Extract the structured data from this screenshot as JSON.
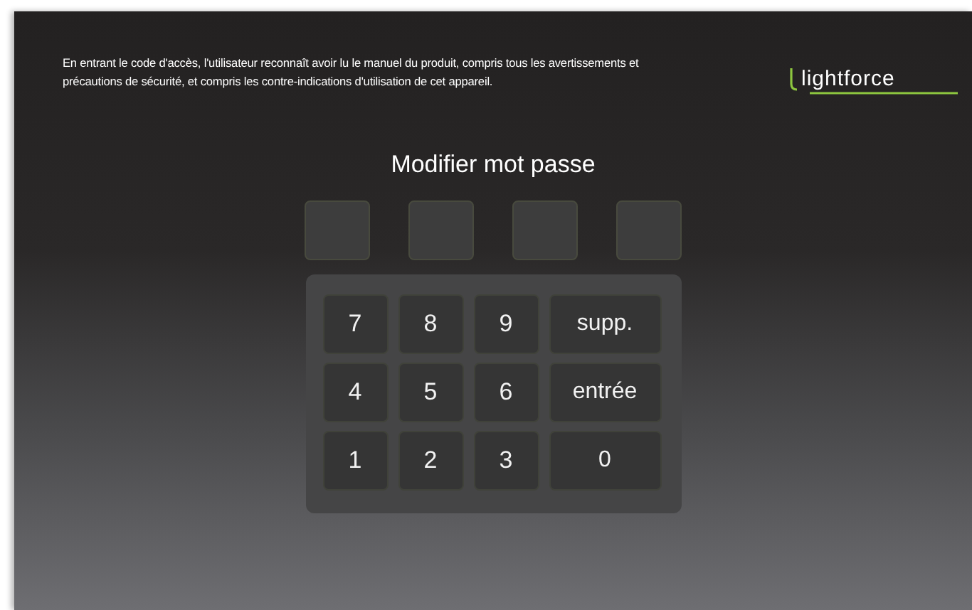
{
  "notice": "En entrant le code d'accès, l'utilisateur reconnaît avoir lu le manuel du produit, compris tous les avertissements et précautions de sécurité, et compris les contre-indications d'utilisation de cet appareil.",
  "logo": "lightforce",
  "title": "Modifier mot passe",
  "code_slots": [
    {
      "filled": false
    },
    {
      "filled": false
    },
    {
      "filled": false
    },
    {
      "filled": false
    }
  ],
  "keys": [
    {
      "label": "7",
      "kind": "digit"
    },
    {
      "label": "8",
      "kind": "digit"
    },
    {
      "label": "9",
      "kind": "digit"
    },
    {
      "label": "supp.",
      "kind": "action"
    },
    {
      "label": "4",
      "kind": "digit"
    },
    {
      "label": "5",
      "kind": "digit"
    },
    {
      "label": "6",
      "kind": "digit"
    },
    {
      "label": "entrée",
      "kind": "action"
    },
    {
      "label": "1",
      "kind": "digit"
    },
    {
      "label": "2",
      "kind": "digit"
    },
    {
      "label": "3",
      "kind": "digit"
    },
    {
      "label": "0",
      "kind": "action"
    }
  ]
}
